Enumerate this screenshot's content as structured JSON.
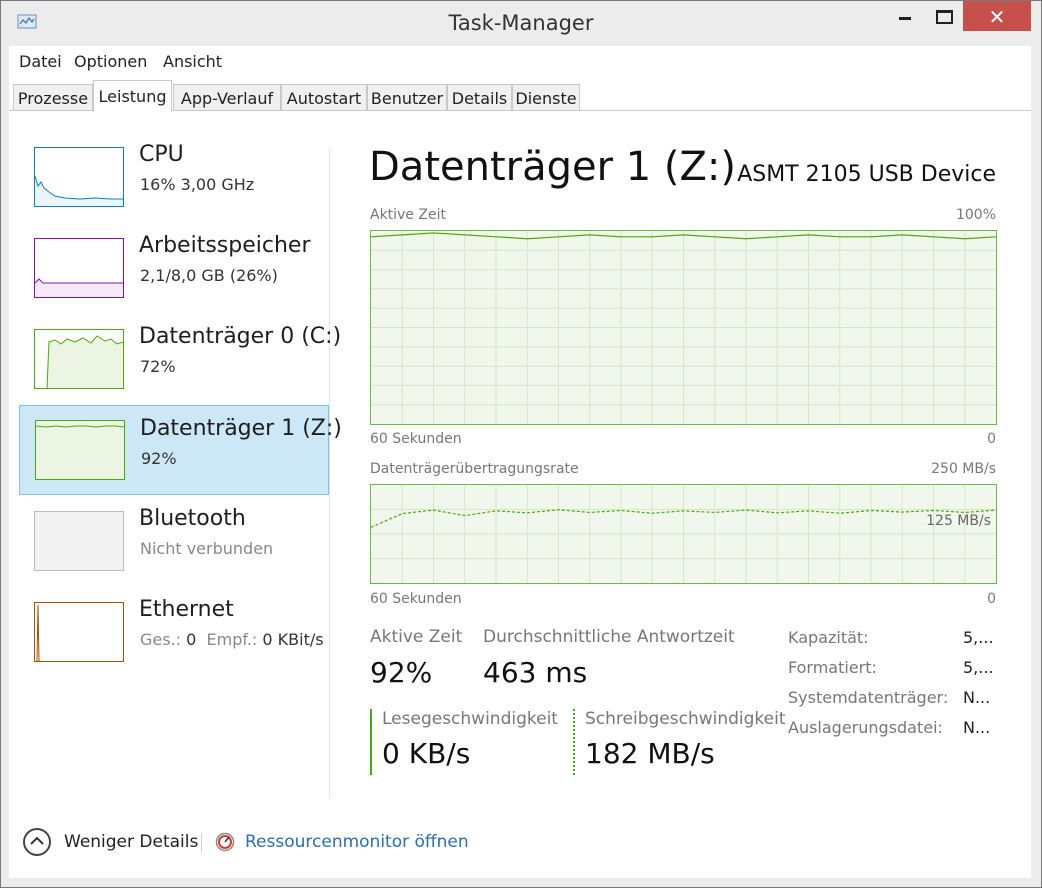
{
  "window": {
    "title": "Task-Manager",
    "close_glyph": "✕"
  },
  "menu": [
    "Datei",
    "Optionen",
    "Ansicht"
  ],
  "tabs": [
    "Prozesse",
    "Leistung",
    "App-Verlauf",
    "Autostart",
    "Benutzer",
    "Details",
    "Dienste"
  ],
  "active_tab": "Leistung",
  "sidebar": [
    {
      "title": "CPU",
      "sub": "16%  3,00 GHz",
      "color": "#117dbb",
      "icon": "cpu-graph"
    },
    {
      "title": "Arbeitsspeicher",
      "sub": "2,1/8,0 GB (26%)",
      "color": "#8b12ae",
      "icon": "memory-graph"
    },
    {
      "title": "Datenträger 0 (C:)",
      "sub": "72%",
      "color": "#4da60c",
      "icon": "disk-graph"
    },
    {
      "title": "Datenträger 1 (Z:)",
      "sub": "92%",
      "color": "#4da60c",
      "icon": "disk-graph",
      "selected": true
    },
    {
      "title": "Bluetooth",
      "sub": "Nicht verbunden",
      "color": "#bcbcbc",
      "icon": "bluetooth-graph"
    },
    {
      "title": "Ethernet",
      "sub_ges_label": "Ges.:",
      "sub_ges_val": "0",
      "sub_empf_label": "Empf.:",
      "sub_empf_val": "0 KBit/s",
      "color": "#a74f01",
      "icon": "ethernet-graph"
    }
  ],
  "main": {
    "title": "Datenträger 1 (Z:)",
    "device": "ASMT 2105 USB Device",
    "graph1": {
      "label": "Aktive Zeit",
      "max": "100%",
      "x_left": "60 Sekunden",
      "x_right": "0",
      "level_percent": 92
    },
    "graph2": {
      "label": "Datenträgerübertragungsrate",
      "max": "250 MB/s",
      "mid": "125 MB/s",
      "x_left": "60 Sekunden",
      "x_right": "0",
      "level_mb_s": 182
    },
    "stats": {
      "active_time_label": "Aktive Zeit",
      "active_time_value": "92%",
      "response_label": "Durchschnittliche Antwortzeit",
      "response_value": "463 ms",
      "read_label": "Lesegeschwindigkeit",
      "read_value": "0 KB/s",
      "write_label": "Schreibgeschwindigkeit",
      "write_value": "182 MB/s"
    },
    "props": [
      {
        "label": "Kapazität:",
        "value": "5,..."
      },
      {
        "label": "Formatiert:",
        "value": "5,..."
      },
      {
        "label": "Systemdatenträger:",
        "value": "N..."
      },
      {
        "label": "Auslagerungsdatei:",
        "value": "N..."
      }
    ]
  },
  "footer": {
    "less_details": "Weniger Details",
    "resource_monitor": "Ressourcenmonitor öffnen",
    "link_color": "#2b6db0"
  }
}
